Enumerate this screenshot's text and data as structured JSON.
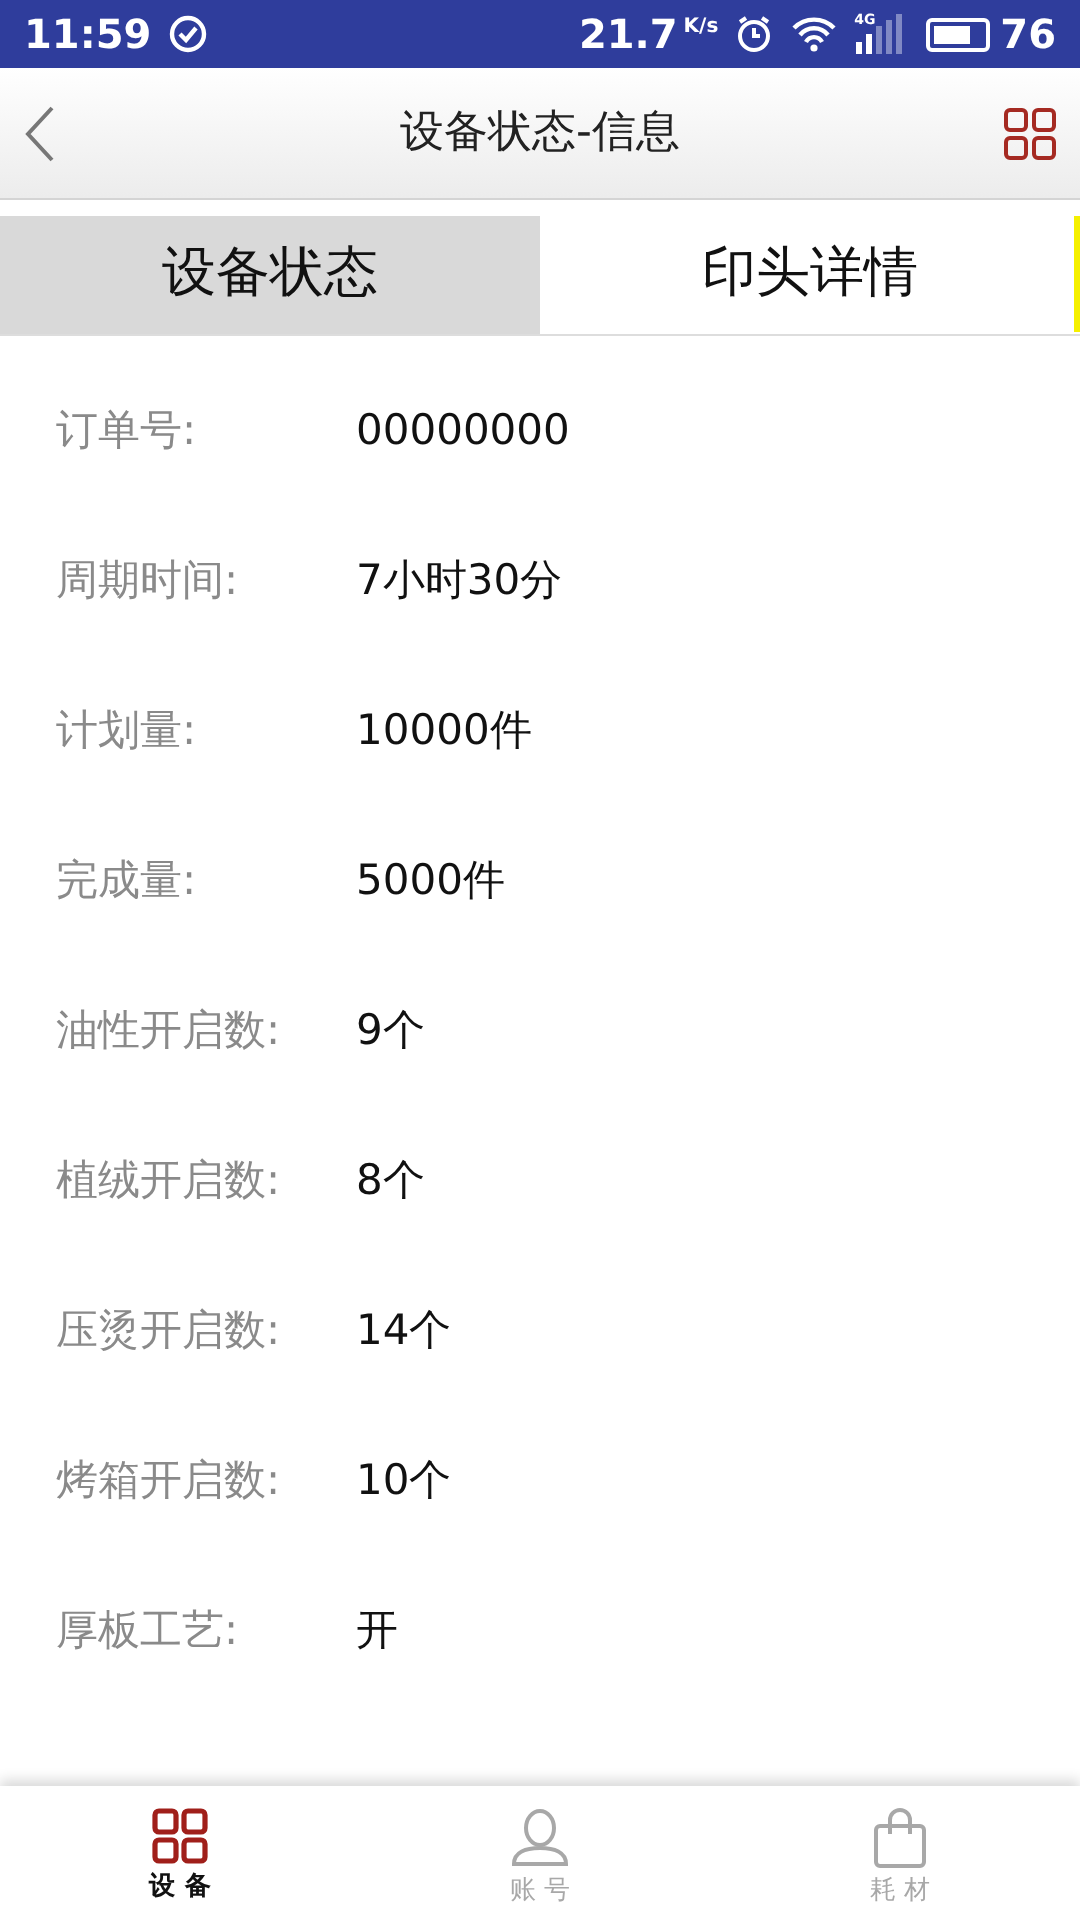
{
  "status_bar": {
    "time": "11:59",
    "speed": "21.7",
    "speed_unit": "K/s",
    "network": "4G",
    "battery": "76"
  },
  "header": {
    "title": "设备状态-信息"
  },
  "tabs": [
    {
      "label": "设备状态",
      "selected": true
    },
    {
      "label": "印头详情",
      "selected": false
    }
  ],
  "fields": [
    {
      "label": "订单号:",
      "value": "00000000"
    },
    {
      "label": "周期时间:",
      "value": "7小时30分"
    },
    {
      "label": "计划量:",
      "value": "10000件"
    },
    {
      "label": "完成量:",
      "value": "5000件"
    },
    {
      "label": "油性开启数:",
      "value": "9个"
    },
    {
      "label": "植绒开启数:",
      "value": "8个"
    },
    {
      "label": "压烫开启数:",
      "value": "14个"
    },
    {
      "label": "烤箱开启数:",
      "value": "10个"
    },
    {
      "label": "厚板工艺:",
      "value": "开"
    }
  ],
  "bottom_nav": [
    {
      "kind": "grid",
      "label": "设 备",
      "selected": true
    },
    {
      "kind": "person",
      "label": "账 号",
      "selected": false
    },
    {
      "kind": "bag",
      "label": "耗 材",
      "selected": false
    }
  ]
}
